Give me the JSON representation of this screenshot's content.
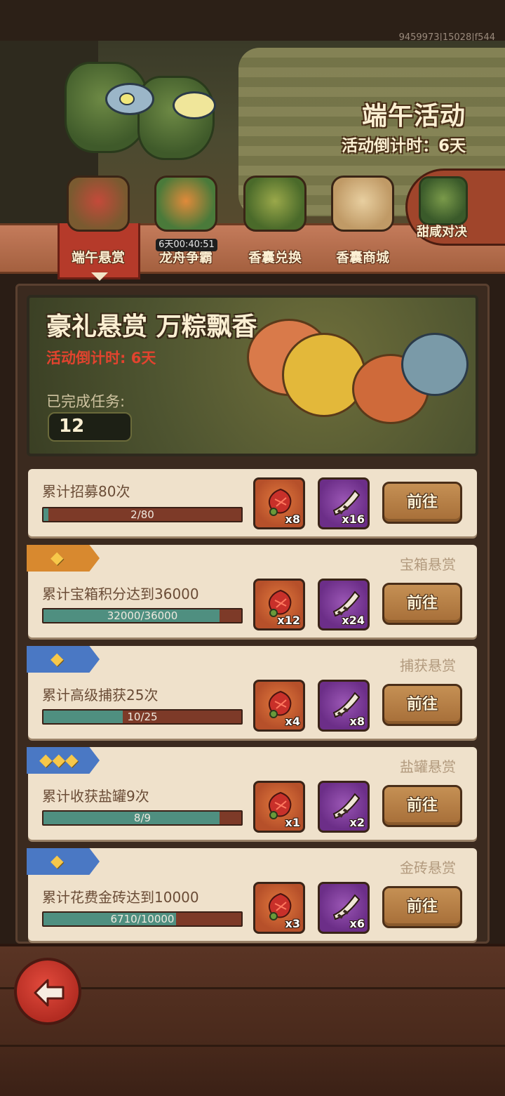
{
  "debug_id": "9459973|15028|f544",
  "event": {
    "title": "端午活动",
    "countdown": "活动倒计时：6天"
  },
  "tabs": [
    {
      "label": "端午悬赏",
      "active": true,
      "icon": "zongzi-basket-icon"
    },
    {
      "label": "龙舟争霸",
      "active": false,
      "icon": "dragon-boat-icon",
      "timer": "6天00:40:51"
    },
    {
      "label": "香囊兑换",
      "active": false,
      "icon": "sachet-exchange-icon"
    },
    {
      "label": "香囊商城",
      "active": false,
      "icon": "sachet-shop-icon"
    }
  ],
  "side_tab": {
    "label": "甜咸对决",
    "icon": "zongzi-duel-icon"
  },
  "banner": {
    "title": "豪礼悬赏 万粽飘香",
    "countdown": "活动倒计时: 6天",
    "completed_label": "已完成任务:",
    "completed_value": "12"
  },
  "tasks": [
    {
      "category": "",
      "name": "累计招募80次",
      "progress_text": "2/80",
      "progress": 0.025,
      "rewards": [
        {
          "icon": "zongzi-reward-icon",
          "qty": "x8"
        },
        {
          "icon": "horn-reward-icon",
          "qty": "x16"
        }
      ],
      "button": "前往"
    },
    {
      "category": "宝箱悬赏",
      "stars": "◆",
      "tag_color": "#d8892f",
      "name": "累计宝箱积分达到36000",
      "progress_text": "32000/36000",
      "progress": 0.889,
      "rewards": [
        {
          "icon": "zongzi-reward-icon",
          "qty": "x12"
        },
        {
          "icon": "horn-reward-icon",
          "qty": "x24"
        }
      ],
      "button": "前往"
    },
    {
      "category": "捕获悬赏",
      "stars": "◆",
      "tag_color": "#4a78c4",
      "name": "累计高级捕获25次",
      "progress_text": "10/25",
      "progress": 0.4,
      "rewards": [
        {
          "icon": "zongzi-reward-icon",
          "qty": "x4"
        },
        {
          "icon": "horn-reward-icon",
          "qty": "x8"
        }
      ],
      "button": "前往"
    },
    {
      "category": "盐罐悬赏",
      "stars": "◆◆◆",
      "tag_color": "#4a78c4",
      "name": "累计收获盐罐9次",
      "progress_text": "8/9",
      "progress": 0.889,
      "rewards": [
        {
          "icon": "zongzi-reward-icon",
          "qty": "x1"
        },
        {
          "icon": "horn-reward-icon",
          "qty": "x2"
        }
      ],
      "button": "前往"
    },
    {
      "category": "金砖悬赏",
      "stars": "◆",
      "tag_color": "#4a78c4",
      "name": "累计花费金砖达到10000",
      "progress_text": "6710/10000",
      "progress": 0.671,
      "rewards": [
        {
          "icon": "zongzi-reward-icon",
          "qty": "x3"
        },
        {
          "icon": "horn-reward-icon",
          "qty": "x6"
        }
      ],
      "button": "前往"
    }
  ],
  "back_button": {
    "icon": "back-arrow-icon"
  }
}
